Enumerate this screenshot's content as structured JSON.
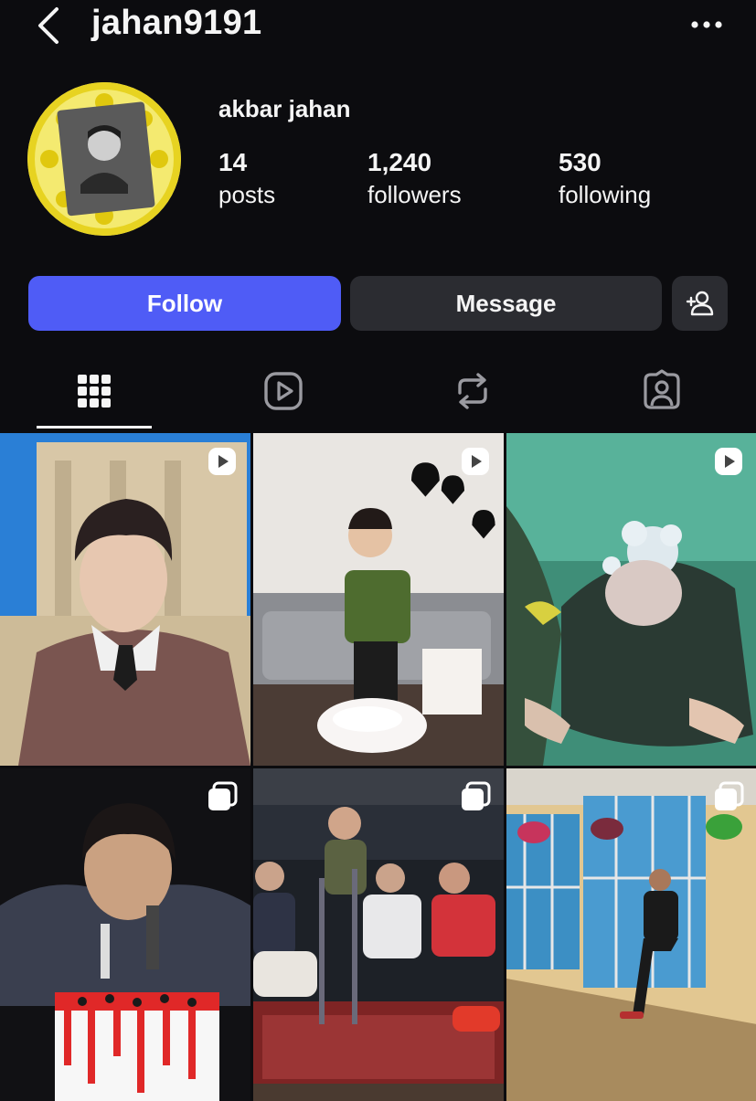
{
  "header": {
    "username": "jahan9191",
    "back_icon": "chevron-left-icon",
    "more_icon": "more-horizontal-icon"
  },
  "profile": {
    "name": "akbar jahan",
    "stats": [
      {
        "value": "14",
        "label": "posts"
      },
      {
        "value": "1,240",
        "label": "followers"
      },
      {
        "value": "530",
        "label": "following"
      }
    ]
  },
  "actions": {
    "follow_label": "Follow",
    "message_label": "Message",
    "add_user_icon": "add-user-icon"
  },
  "tabs": [
    {
      "icon": "grid-icon",
      "selected": true
    },
    {
      "icon": "reels-icon",
      "selected": false
    },
    {
      "icon": "reposts-icon",
      "selected": false
    },
    {
      "icon": "tagged-icon",
      "selected": false
    }
  ],
  "posts": [
    {
      "type": "reel",
      "badge": "reel-icon"
    },
    {
      "type": "reel",
      "badge": "reel-icon"
    },
    {
      "type": "reel",
      "badge": "reel-icon"
    },
    {
      "type": "carousel",
      "badge": "carousel-icon"
    },
    {
      "type": "carousel",
      "badge": "carousel-icon"
    },
    {
      "type": "carousel",
      "badge": "carousel-icon"
    }
  ],
  "colors": {
    "background": "#0c0c0f",
    "follow_button": "#4f5cf6",
    "secondary_button": "#2b2c31",
    "text": "#f5f5f5"
  }
}
